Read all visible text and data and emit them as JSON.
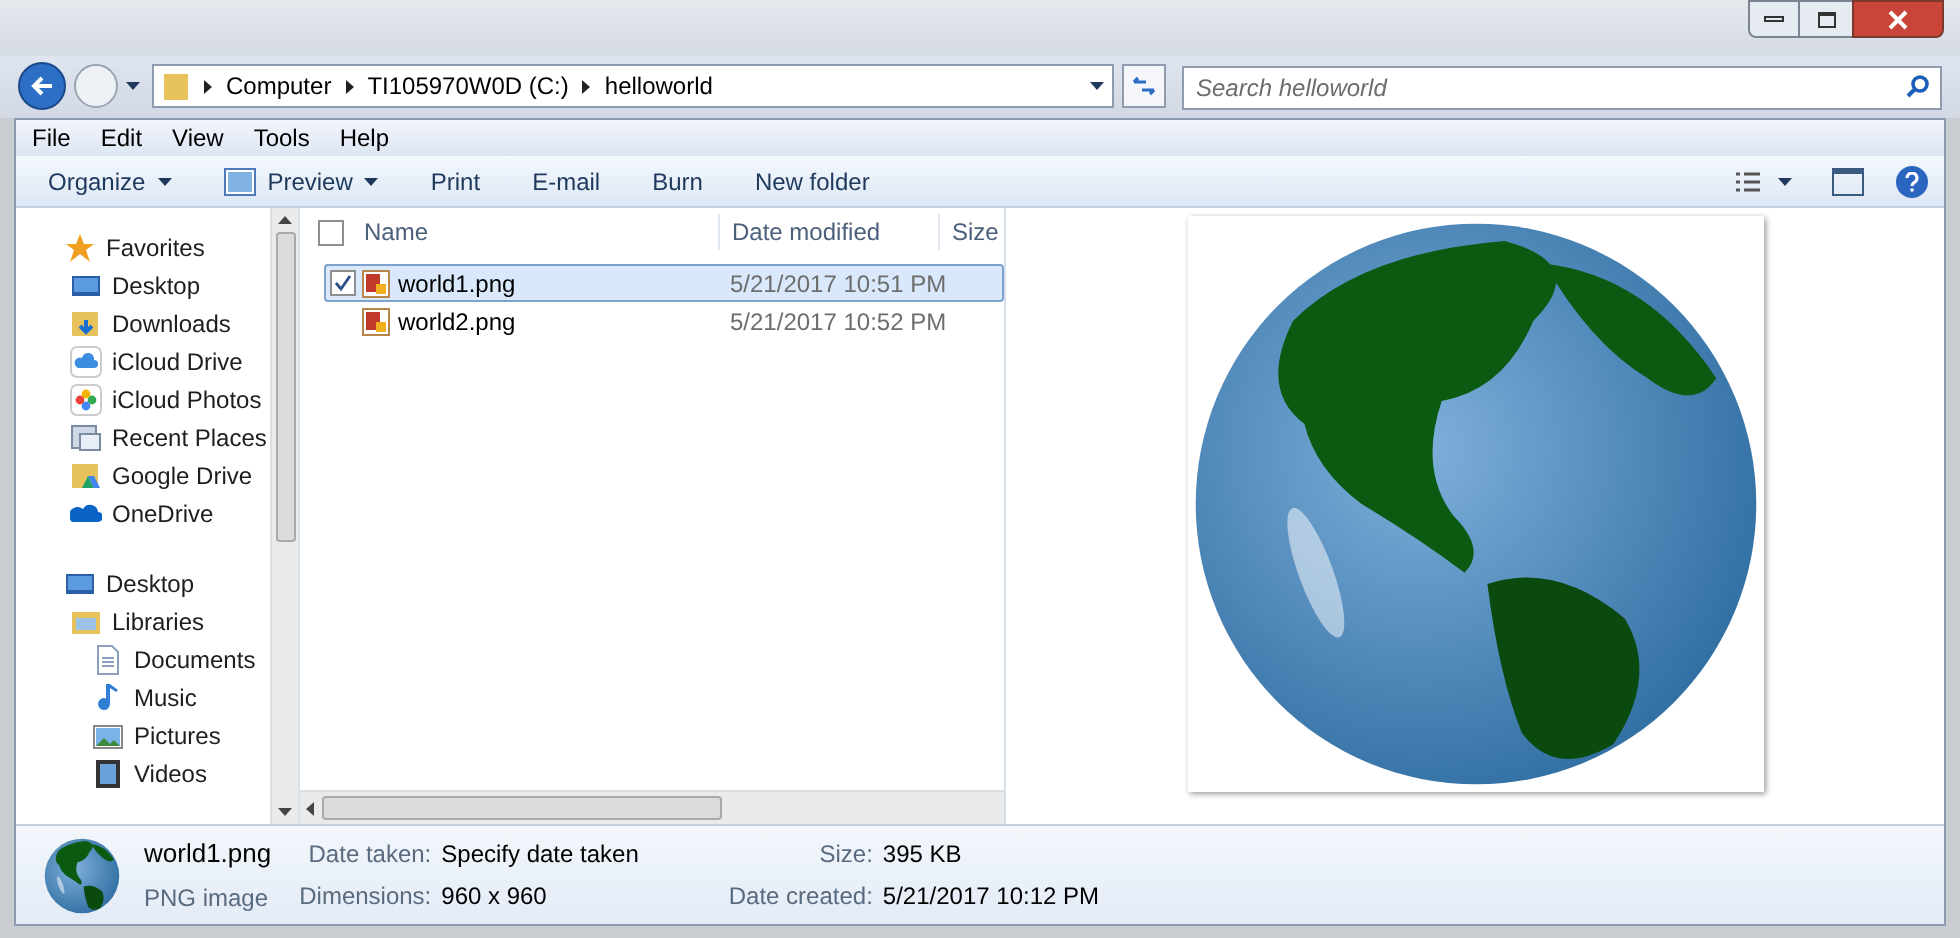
{
  "address_bar": {
    "crumbs": [
      "Computer",
      "TI105970W0D (C:)",
      "helloworld"
    ]
  },
  "search": {
    "placeholder": "Search helloworld"
  },
  "menu": [
    "File",
    "Edit",
    "View",
    "Tools",
    "Help"
  ],
  "toolbar": [
    {
      "label": "Organize",
      "dropdown": true,
      "icon": false
    },
    {
      "label": "Preview",
      "dropdown": true,
      "icon": true
    },
    {
      "label": "Print",
      "dropdown": false,
      "icon": false
    },
    {
      "label": "E-mail",
      "dropdown": false,
      "icon": false
    },
    {
      "label": "Burn",
      "dropdown": false,
      "icon": false
    },
    {
      "label": "New folder",
      "dropdown": false,
      "icon": false
    }
  ],
  "nav": [
    {
      "label": "Favorites",
      "kind": "star",
      "children": [
        {
          "label": "Desktop",
          "kind": "desktop"
        },
        {
          "label": "Downloads",
          "kind": "downloads"
        },
        {
          "label": "iCloud Drive",
          "kind": "cloud"
        },
        {
          "label": "iCloud Photos",
          "kind": "photos"
        },
        {
          "label": "Recent Places",
          "kind": "recent"
        },
        {
          "label": "Google Drive",
          "kind": "gdrive"
        },
        {
          "label": "OneDrive",
          "kind": "onedrive"
        }
      ]
    },
    {
      "label": "Desktop",
      "kind": "desktop",
      "children": [
        {
          "label": "Libraries",
          "kind": "libraries",
          "children": [
            {
              "label": "Documents",
              "kind": "documents"
            },
            {
              "label": "Music",
              "kind": "music"
            },
            {
              "label": "Pictures",
              "kind": "pictures"
            },
            {
              "label": "Videos",
              "kind": "videos"
            }
          ]
        }
      ]
    }
  ],
  "file_list": {
    "columns": [
      "Name",
      "Date modified",
      "Size"
    ],
    "select_all_checked": false,
    "rows": [
      {
        "name": "world1.png",
        "date_modified": "5/21/2017 10:51 PM",
        "selected": true,
        "checked": true
      },
      {
        "name": "world2.png",
        "date_modified": "5/21/2017 10:52 PM",
        "selected": false,
        "checked": false
      }
    ]
  },
  "details": {
    "name": "world1.png",
    "type": "PNG image",
    "fields": [
      {
        "label": "Date taken:",
        "value": "Specify date taken"
      },
      {
        "label": "Size:",
        "value": "395 KB"
      },
      {
        "label": "Dimensions:",
        "value": "960 x 960"
      },
      {
        "label": "Date created:",
        "value": "5/21/2017 10:12 PM"
      }
    ]
  }
}
